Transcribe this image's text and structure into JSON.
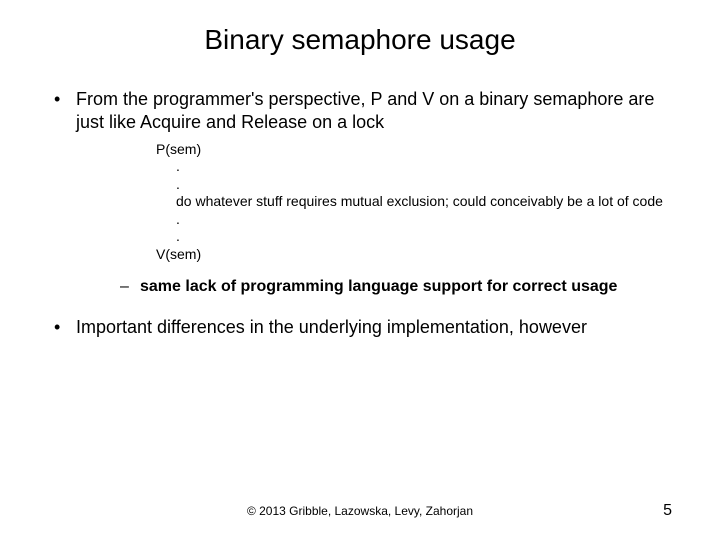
{
  "title": "Binary semaphore usage",
  "bullets": {
    "b1": "From the programmer's perspective, P and V on a binary semaphore are just like Acquire and Release on a lock",
    "b2": "Important differences in the underlying implementation, however"
  },
  "code": {
    "l1": "P(sem)",
    "l2": ".",
    "l3": ".",
    "l4": "do whatever stuff requires mutual exclusion; could conceivably be a lot of code",
    "l5": ".",
    "l6": ".",
    "l7": "V(sem)"
  },
  "sub": {
    "s1": "same lack of programming language support for correct usage"
  },
  "footer": "© 2013 Gribble, Lazowska, Levy, Zahorjan",
  "page_number": "5"
}
